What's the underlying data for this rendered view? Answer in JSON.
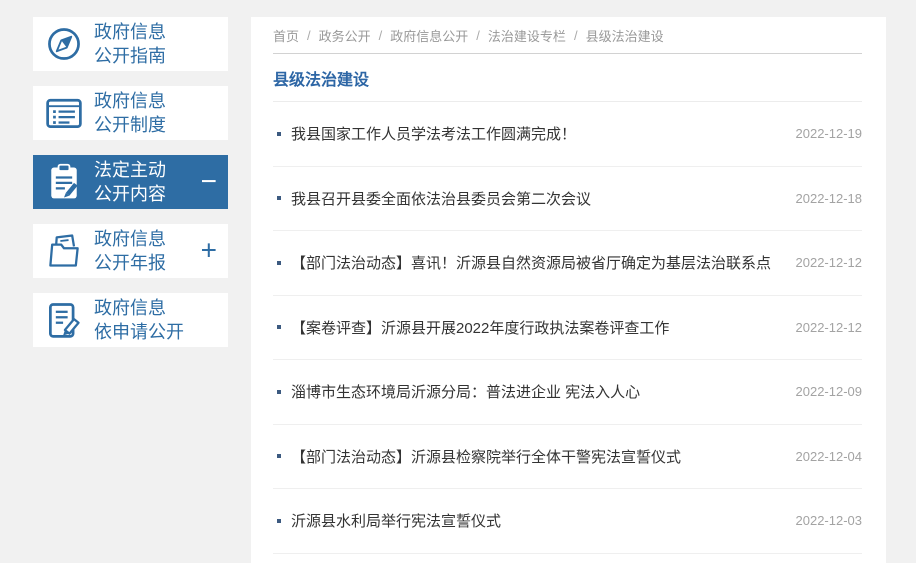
{
  "colors": {
    "accent_blue": "#2e6da4",
    "title_blue": "#2d66a5",
    "page_background": "#f1f1f1",
    "article_text": "#333333",
    "date_text": "#a3a3a3",
    "breadcrumb_text": "#999999"
  },
  "sidebar": {
    "items": [
      {
        "label_line1": "政府信息",
        "label_line2": "公开指南",
        "icon": "compass-icon",
        "active": false,
        "toggle": ""
      },
      {
        "label_line1": "政府信息",
        "label_line2": "公开制度",
        "icon": "document-list-icon",
        "active": false,
        "toggle": ""
      },
      {
        "label_line1": "法定主动",
        "label_line2": "公开内容",
        "icon": "clipboard-pen-icon",
        "active": true,
        "toggle": "−"
      },
      {
        "label_line1": "政府信息",
        "label_line2": "公开年报",
        "icon": "folder-icon",
        "active": false,
        "toggle": "+"
      },
      {
        "label_line1": "政府信息",
        "label_line2": "依申请公开",
        "icon": "document-pen-icon",
        "active": false,
        "toggle": ""
      }
    ]
  },
  "breadcrumb": {
    "separator": "/",
    "items": [
      {
        "label": "首页"
      },
      {
        "label": "政务公开"
      },
      {
        "label": "政府信息公开"
      },
      {
        "label": "法治建设专栏"
      },
      {
        "label": "县级法治建设"
      }
    ]
  },
  "section": {
    "title": "县级法治建设"
  },
  "articles": [
    {
      "title": "我县国家工作人员学法考法工作圆满完成！",
      "date": "2022-12-19"
    },
    {
      "title": "我县召开县委全面依法治县委员会第二次会议",
      "date": "2022-12-18"
    },
    {
      "title": "【部门法治动态】喜讯！沂源县自然资源局被省厅确定为基层法治联系点",
      "date": "2022-12-12"
    },
    {
      "title": "【案卷评查】沂源县开展2022年度行政执法案卷评查工作",
      "date": "2022-12-12"
    },
    {
      "title": "淄博市生态环境局沂源分局：普法进企业 宪法入人心",
      "date": "2022-12-09"
    },
    {
      "title": "【部门法治动态】沂源县检察院举行全体干警宪法宣誓仪式",
      "date": "2022-12-04"
    },
    {
      "title": "沂源县水利局举行宪法宣誓仪式",
      "date": "2022-12-03"
    }
  ]
}
